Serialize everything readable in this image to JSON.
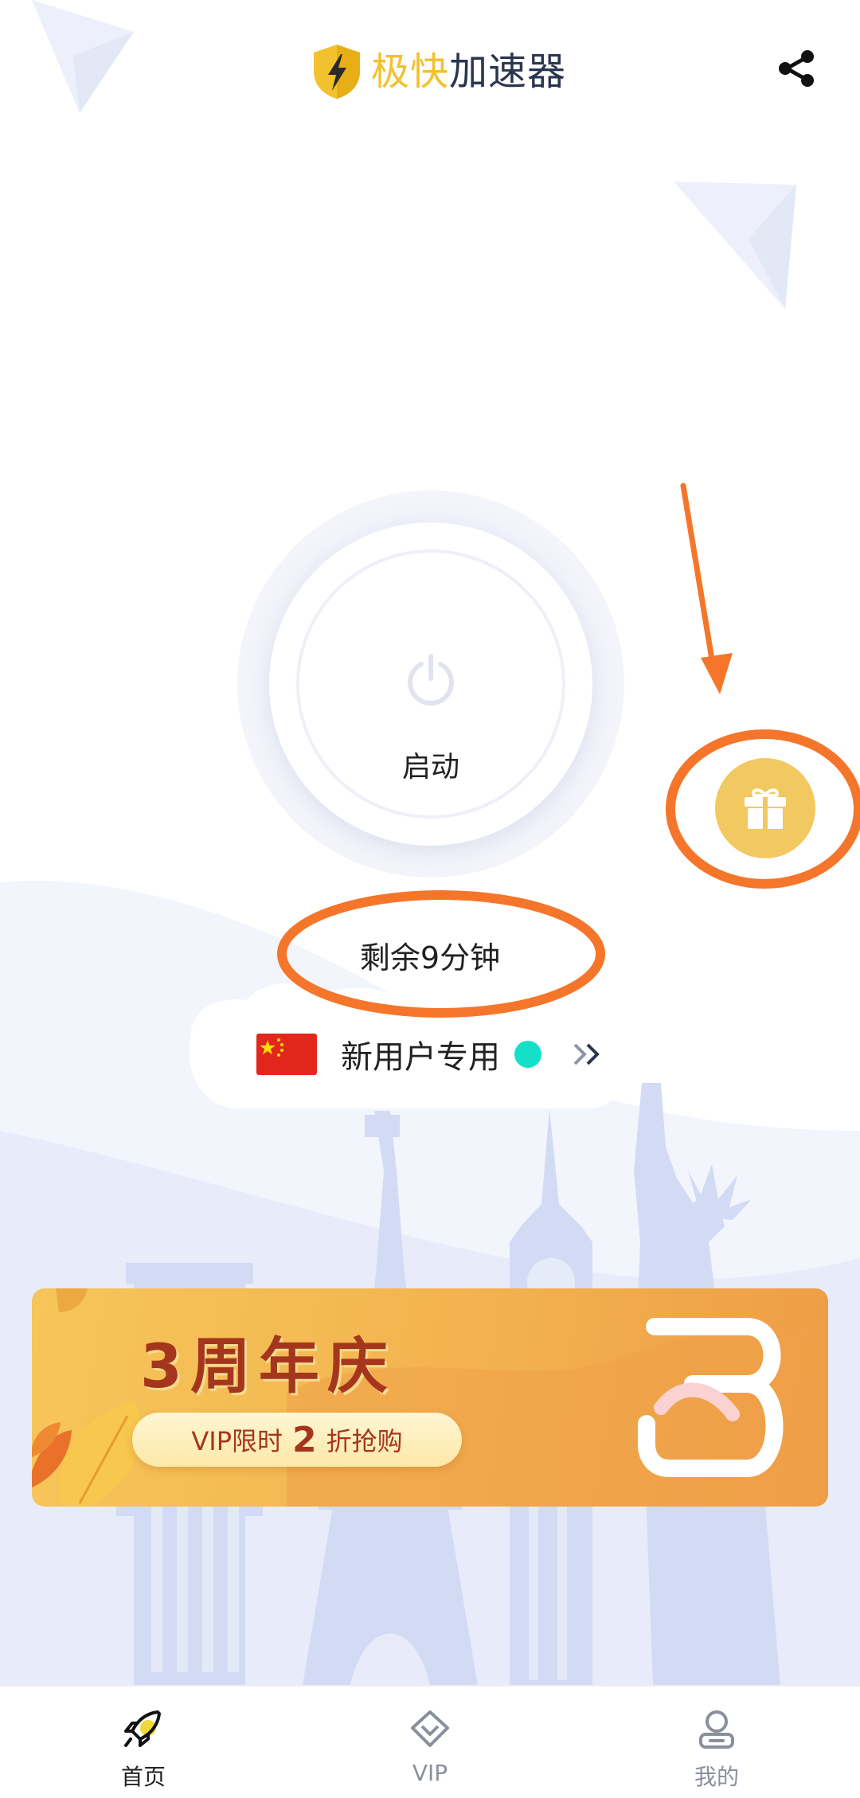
{
  "header": {
    "app_name_highlight": "极快",
    "app_name_rest": "加速器",
    "share_icon": "share-icon"
  },
  "power": {
    "label": "启动",
    "icon": "power-icon"
  },
  "gift": {
    "icon": "gift-icon"
  },
  "remaining_time": "剩余9分钟",
  "server": {
    "flag": "china-flag",
    "name": "新用户专用",
    "status_color": "#14E0C8",
    "chevron_icon": "double-chevron-right-icon"
  },
  "banner": {
    "title": "3周年庆",
    "subtitle_prefix": "VIP限时",
    "subtitle_number": "2",
    "subtitle_suffix": "折抢购",
    "accent_color": "#A5361E"
  },
  "bottom_nav": {
    "items": [
      {
        "label": "首页",
        "icon": "rocket-icon",
        "active": true
      },
      {
        "label": "VIP",
        "icon": "vip-diamond-icon",
        "active": false
      },
      {
        "label": "我的",
        "icon": "profile-icon",
        "active": false
      }
    ]
  },
  "colors": {
    "brand_yellow": "#F2C12E",
    "brand_dark": "#2A3550",
    "annotation_orange": "#F5762A",
    "gift_bg": "#F2C960"
  }
}
